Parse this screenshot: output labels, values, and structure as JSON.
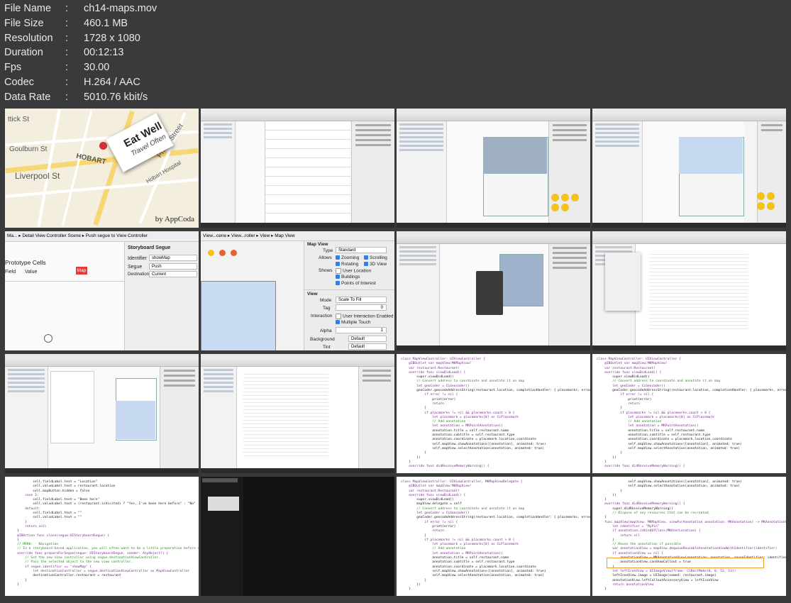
{
  "file_info": [
    {
      "key": "File Name",
      "value": "ch14-maps.mov"
    },
    {
      "key": "File Size",
      "value": "460.1 MB"
    },
    {
      "key": "Resolution",
      "value": "1728 x 1080"
    },
    {
      "key": "Duration",
      "value": "00:12:13"
    },
    {
      "key": "Fps",
      "value": "30.00"
    },
    {
      "key": "Codec",
      "value": "H.264 / AAC"
    },
    {
      "key": "Data Rate",
      "value": "5010.76 kbit/s"
    }
  ],
  "separator": ":",
  "thumb1": {
    "card_title": "Eat Well",
    "card_sub": "Travel Often",
    "brand": "by AppCoda",
    "streets": [
      "Liverpool St",
      "Goulburn St",
      "HOBART",
      "Phillip Street",
      "Hobart Hospital",
      "ttick St"
    ]
  },
  "thumb5": {
    "crumb": "Ma... ▸ Detail View Controller Scene ▸ Push segue to View Controller",
    "section": "Prototype Cells",
    "col_field": "Field",
    "col_value": "Value",
    "map_btn": "Map",
    "inspector_title": "Storyboard Segue",
    "identifier_label": "Identifier",
    "identifier_value": "showMap",
    "segue_label": "Segue",
    "segue_value": "Push",
    "destination_label": "Destination",
    "destination_value": "Current"
  },
  "thumb6": {
    "crumb": "View...cene ▸ View...roller ▸ View ▸ Map View",
    "panel_title": "Map View",
    "type_label": "Type",
    "type_value": "Standard",
    "allows_label": "Allows",
    "allows": [
      "Zooming",
      "Scrolling",
      "Rotating",
      "3D View"
    ],
    "shows_label": "Shows",
    "shows": [
      "User Location",
      "Buildings",
      "Points of Interest"
    ],
    "view_section": "View",
    "mode_label": "Mode",
    "mode_value": "Scale To Fill",
    "tag_label": "Tag",
    "tag_value": "0",
    "interaction_label": "Interaction",
    "interaction": [
      "User Interaction Enabled",
      "Multiple Touch"
    ],
    "alpha_label": "Alpha",
    "alpha_value": "1",
    "background_label": "Background",
    "background_value": "Default",
    "tint_label": "Tint",
    "tint_value": "Default"
  },
  "code_a": [
    "class MapViewController: UIViewController {",
    "",
    "    @IBOutlet var mapView:MKMapView!",
    "",
    "    var restaurant:Restaurant!",
    "",
    "    override func viewDidLoad() {",
    "        super.viewDidLoad()",
    "",
    "        // Convert address to coordinate and annotate it on map",
    "        let geoCoder = CLGeocoder()",
    "        geoCoder.geocodeAddressString(restaurant.location, completionHandler: { placemarks, error in",
    "",
    "            if error != nil {",
    "                print(error)",
    "                return",
    "            }",
    "",
    "            if placemarks != nil && placemarks.count > 0 {",
    "                let placemark = placemarks[0] as CLPlacemark",
    "",
    "                // Add annotation",
    "                let annotation = MKPointAnnotation()",
    "                annotation.title = self.restaurant.name",
    "                annotation.subtitle = self.restaurant.type",
    "                annotation.coordinate = placemark.location.coordinate",
    "",
    "                self.mapView.showAnnotations([annotation], animated: true)",
    "                self.mapView.selectAnnotation(annotation, animated: true)",
    "            }",
    "        })",
    "    }",
    "",
    "    override func didReceiveMemoryWarning() {"
  ],
  "code_b": [
    "            cell.fieldLabel.text = \"Location\"",
    "            cell.valueLabel.text = restaurant.location",
    "            cell.mapButton.hidden = false",
    "        case 3:",
    "            cell.fieldLabel.text = \"Been here\"",
    "            cell.valueLabel.text = (restaurant.isVisited) ? \"Yes, I've been here before\" : \"No\"",
    "        default:",
    "            cell.fieldLabel.text = \"\"",
    "            cell.valueLabel.text = \"\"",
    "        }",
    "",
    "        return cell",
    "    }",
    "",
    "    @IBAction func close(segue:UIStoryboardSegue) {",
    "",
    "    }",
    "",
    "    // MARK: - Navigation",
    "",
    "    // In a storyboard-based application, you will often want to do a little preparation before navigation",
    "    override func prepareForSegue(segue: UIStoryboardSegue, sender: AnyObject?) {",
    "        // Get the new view controller using segue.destinationViewController.",
    "        // Pass the selected object to the new view controller.",
    "        if segue.identifier == \"showMap\" {",
    "            let destinationController = segue.destinationViewController as MapViewController",
    "            destinationController.restaurant = restaurant",
    "        }",
    "    }"
  ],
  "code_c": [
    "class MapViewController: UIViewController, MKMapViewDelegate {",
    "",
    "    @IBOutlet var mapView:MKMapView!",
    "",
    "    var restaurant:Restaurant!",
    "",
    "    override func viewDidLoad() {",
    "        super.viewDidLoad()",
    "",
    "        mapView.delegate = self",
    "",
    "        // Convert address to coordinate and annotate it on map",
    "        let geoCoder = CLGeocoder()",
    "        geoCoder.geocodeAddressString(restaurant.location, completionHandler: { placemarks, error in",
    "",
    "            if error != nil {",
    "                print(error)",
    "                return",
    "            }",
    "",
    "            if placemarks != nil && placemarks.count > 0 {",
    "                let placemark = placemarks[0] as CLPlacemark",
    "",
    "                // Add annotation",
    "                let annotation = MKPointAnnotation()",
    "                annotation.title = self.restaurant.name",
    "                annotation.subtitle = self.restaurant.type",
    "                annotation.coordinate = placemark.location.coordinate",
    "",
    "                self.mapView.showAnnotations([annotation], animated: true)",
    "                self.mapView.selectAnnotation(annotation, animated: true)",
    "            }",
    "        })",
    "    }"
  ],
  "code_d": [
    "                self.mapView.showAnnotations([annotation], animated: true)",
    "                self.mapView.selectAnnotation(annotation, animated: true)",
    "            }",
    "        })",
    "    }",
    "",
    "    override func didReceiveMemoryWarning() {",
    "        super.didReceiveMemoryWarning()",
    "        // Dispose of any resources that can be recreated.",
    "    }",
    "",
    "    func mapView(mapView: MKMapView, viewForAnnotation annotation: MKAnnotation) -> MKAnnotationView? {",
    "        let identifier = \"MyPin\"",
    "",
    "        if annotation.isKindOfClass(MKUserLocation) {",
    "            return nil",
    "        }",
    "",
    "        // Reuse the annotation if possible",
    "        var annotationView = mapView.dequeueReusableAnnotationViewWithIdentifier(identifier)",
    "",
    "        if annotationView == nil {",
    "            annotationView = MKAnnotationView(annotation: annotation, reuseIdentifier: identifier)",
    "            annotationView.canShowCallout = true",
    "        }",
    "",
    "        let leftIconView = UIImageView(frame: CGRectMake(0, 0, 53, 53))",
    "        leftIconView.image = UIImage(named: restaurant.image)",
    "        annotationView.leftCalloutAccessoryView = leftIconView",
    "",
    "        return annotationView",
    "    }"
  ]
}
